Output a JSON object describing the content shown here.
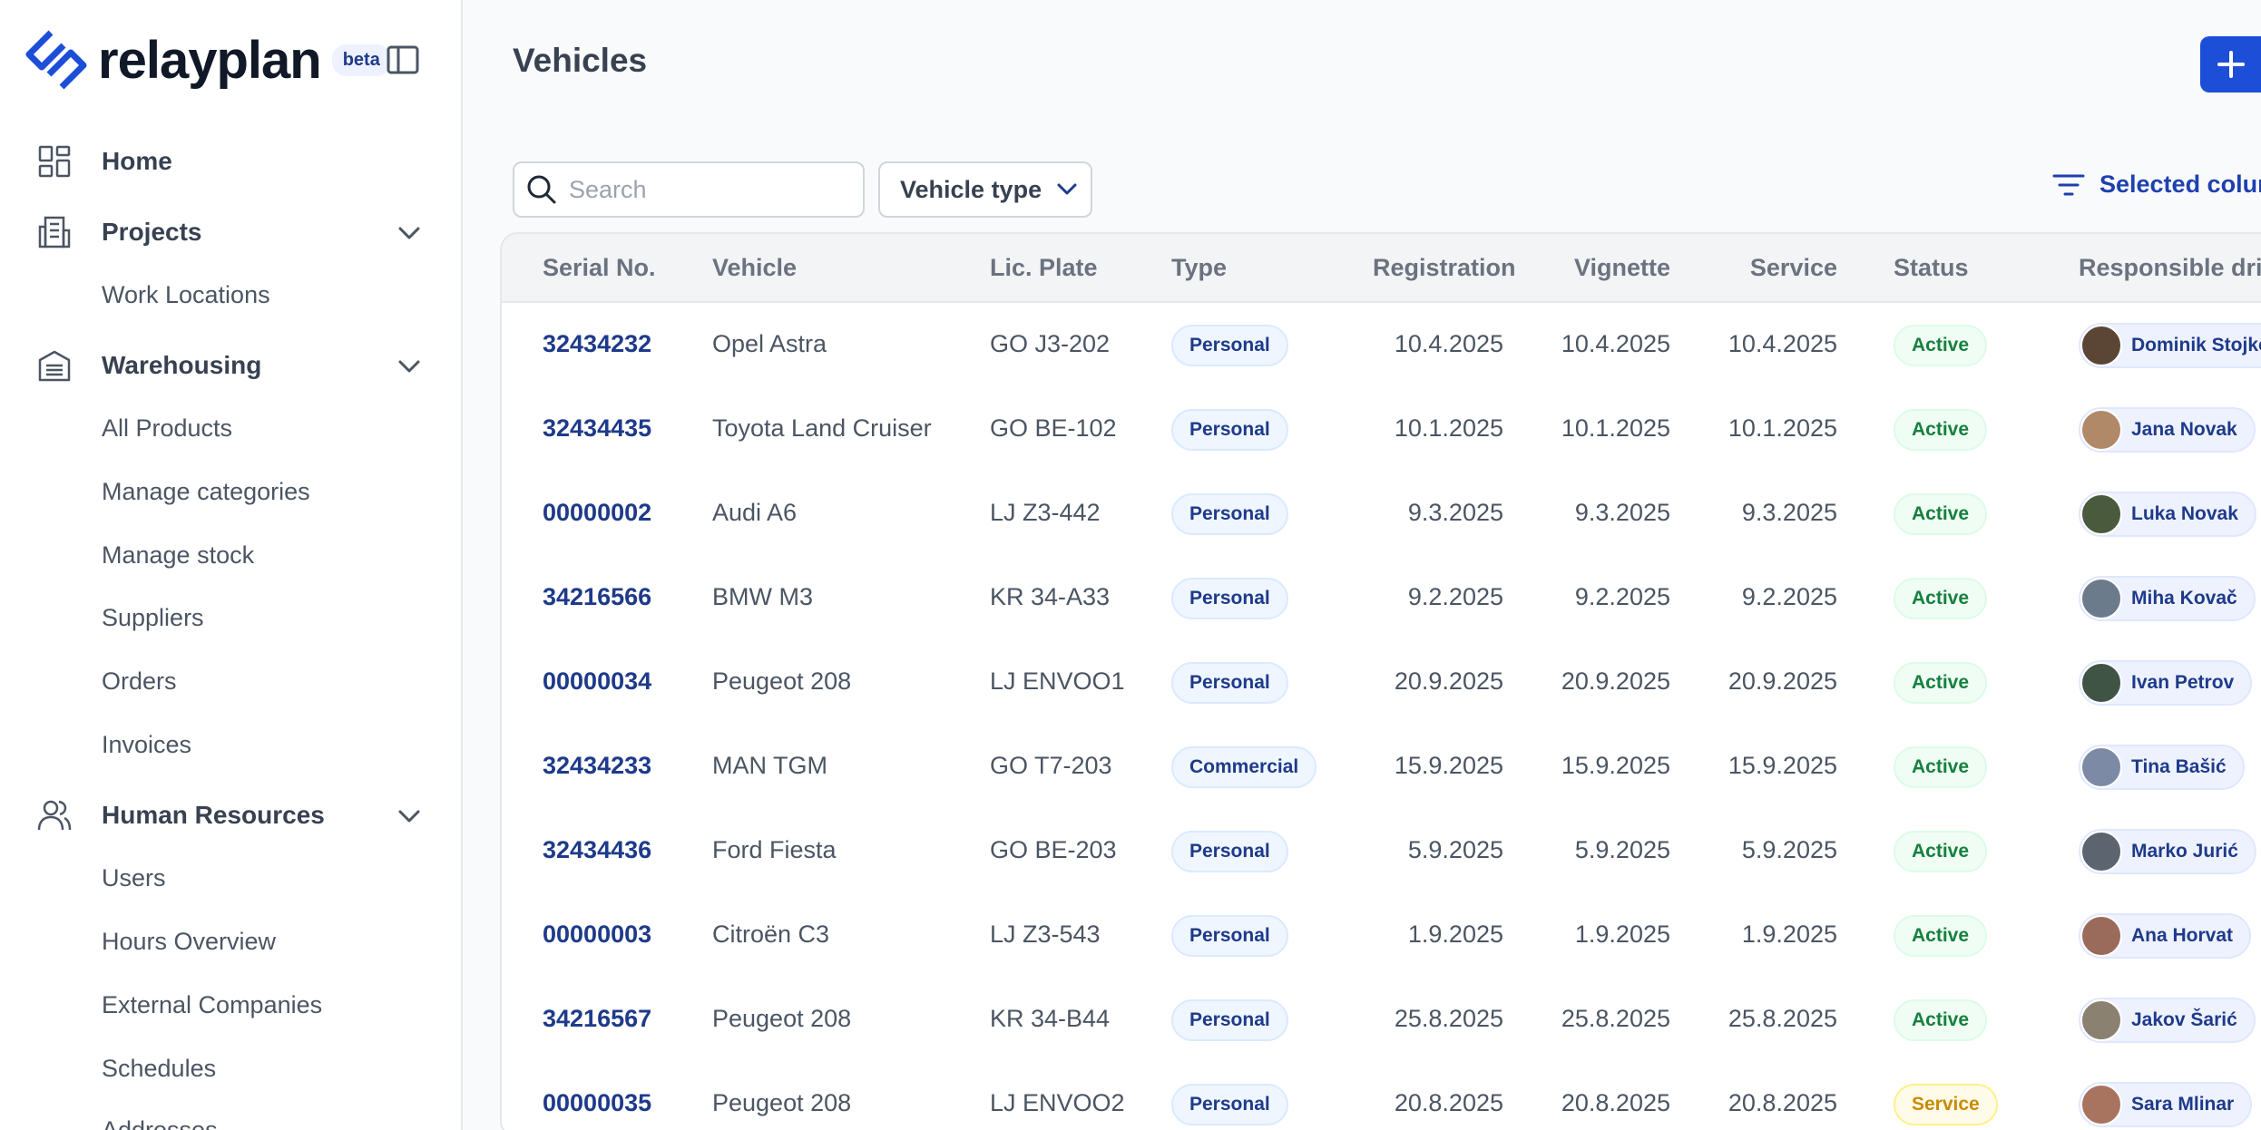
{
  "sidebar": {
    "brand": "relayplan",
    "badge": "beta",
    "nav": [
      {
        "label": "Home",
        "icon": "dashboard-icon"
      },
      {
        "label": "Projects",
        "icon": "building-icon",
        "sub": [
          "Work Locations"
        ]
      },
      {
        "label": "Warehousing",
        "icon": "warehouse-icon",
        "sub": [
          "All Products",
          "Manage categories",
          "Manage stock",
          "Suppliers",
          "Orders",
          "Invoices"
        ]
      },
      {
        "label": "Human Resources",
        "icon": "users-icon",
        "sub": [
          "Users",
          "Hours Overview",
          "External Companies",
          "Schedules",
          "Addresses"
        ]
      }
    ]
  },
  "header": {
    "title": "Vehicles"
  },
  "toolbar": {
    "search_placeholder": "Search",
    "filter_label": "Vehicle type",
    "columns_label": "Selected columns"
  },
  "table": {
    "columns": [
      "Serial No.",
      "Vehicle",
      "Lic. Plate",
      "Type",
      "Registration",
      "Vignette",
      "Service",
      "Status",
      "Responsible driver"
    ],
    "rows": [
      {
        "serial": "32434232",
        "vehicle": "Opel Astra",
        "plate": "GO J3-202",
        "type": "Personal",
        "registration": "10.4.2025",
        "vignette": "10.4.2025",
        "service": "10.4.2025",
        "status": "Active",
        "driver": "Dominik Stojkovič"
      },
      {
        "serial": "32434435",
        "vehicle": "Toyota Land Cruiser",
        "plate": "GO BE-102",
        "type": "Personal",
        "registration": "10.1.2025",
        "vignette": "10.1.2025",
        "service": "10.1.2025",
        "status": "Active",
        "driver": "Jana Novak"
      },
      {
        "serial": "00000002",
        "vehicle": "Audi A6",
        "plate": "LJ Z3-442",
        "type": "Personal",
        "registration": "9.3.2025",
        "vignette": "9.3.2025",
        "service": "9.3.2025",
        "status": "Active",
        "driver": "Luka Novak"
      },
      {
        "serial": "34216566",
        "vehicle": "BMW M3",
        "plate": "KR 34-A33",
        "type": "Personal",
        "registration": "9.2.2025",
        "vignette": "9.2.2025",
        "service": "9.2.2025",
        "status": "Active",
        "driver": "Miha Kovač"
      },
      {
        "serial": "00000034",
        "vehicle": "Peugeot 208",
        "plate": "LJ ENVOO1",
        "type": "Personal",
        "registration": "20.9.2025",
        "vignette": "20.9.2025",
        "service": "20.9.2025",
        "status": "Active",
        "driver": "Ivan Petrov"
      },
      {
        "serial": "32434233",
        "vehicle": "MAN TGM",
        "plate": "GO T7-203",
        "type": "Commercial",
        "registration": "15.9.2025",
        "vignette": "15.9.2025",
        "service": "15.9.2025",
        "status": "Active",
        "driver": "Tina Bašić"
      },
      {
        "serial": "32434436",
        "vehicle": "Ford Fiesta",
        "plate": "GO BE-203",
        "type": "Personal",
        "registration": "5.9.2025",
        "vignette": "5.9.2025",
        "service": "5.9.2025",
        "status": "Active",
        "driver": "Marko Jurić"
      },
      {
        "serial": "00000003",
        "vehicle": "Citroën C3",
        "plate": "LJ Z3-543",
        "type": "Personal",
        "registration": "1.9.2025",
        "vignette": "1.9.2025",
        "service": "1.9.2025",
        "status": "Active",
        "driver": "Ana Horvat"
      },
      {
        "serial": "34216567",
        "vehicle": "Peugeot 208",
        "plate": "KR 34-B44",
        "type": "Personal",
        "registration": "25.8.2025",
        "vignette": "25.8.2025",
        "service": "25.8.2025",
        "status": "Active",
        "driver": "Jakov Šarić"
      },
      {
        "serial": "00000035",
        "vehicle": "Peugeot 208",
        "plate": "LJ ENVOO2",
        "type": "Personal",
        "registration": "20.8.2025",
        "vignette": "20.8.2025",
        "service": "20.8.2025",
        "status": "Service",
        "driver": "Sara Mlinar"
      }
    ]
  },
  "colors": {
    "accent": "#1d4ed8",
    "serial_link": "#1e3a8a",
    "active": "#15803d",
    "service": "#ca8a04",
    "avatars": [
      "#5b4636",
      "#b08968",
      "#4a5a3c",
      "#6b7b8c",
      "#3f5445",
      "#7c8aa5",
      "#5c6470",
      "#9a6b5a",
      "#8a8170",
      "#a8745f"
    ]
  }
}
